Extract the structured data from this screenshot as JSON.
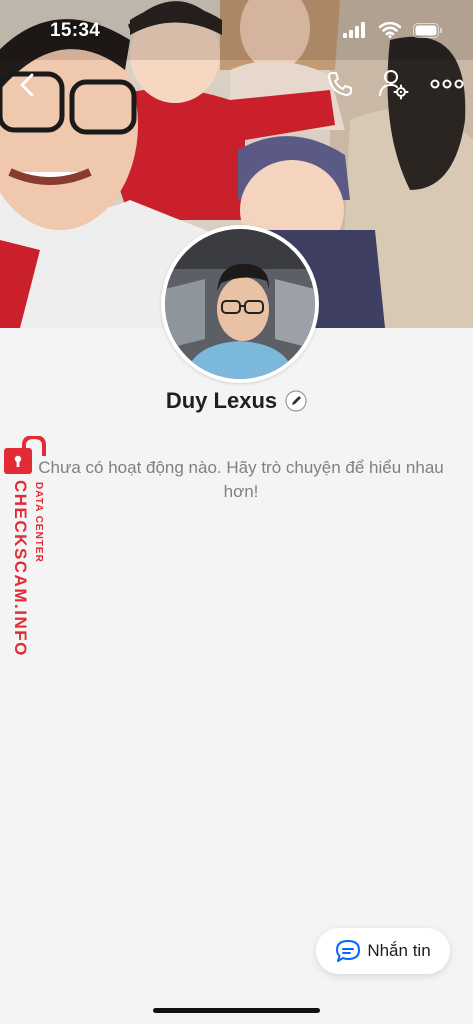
{
  "status_bar": {
    "time": "15:34"
  },
  "profile": {
    "name": "Duy Lexus",
    "empty_message": "Chưa có hoạt động nào. Hãy trò chuyện để hiểu nhau hơn!"
  },
  "actions": {
    "message_label": "Nhắn tin"
  },
  "watermark": {
    "main": "CHECKSCAM.INFO",
    "sub": "DATA CENTER"
  },
  "colors": {
    "accent": "#0068ff",
    "watermark": "#e32b36"
  }
}
